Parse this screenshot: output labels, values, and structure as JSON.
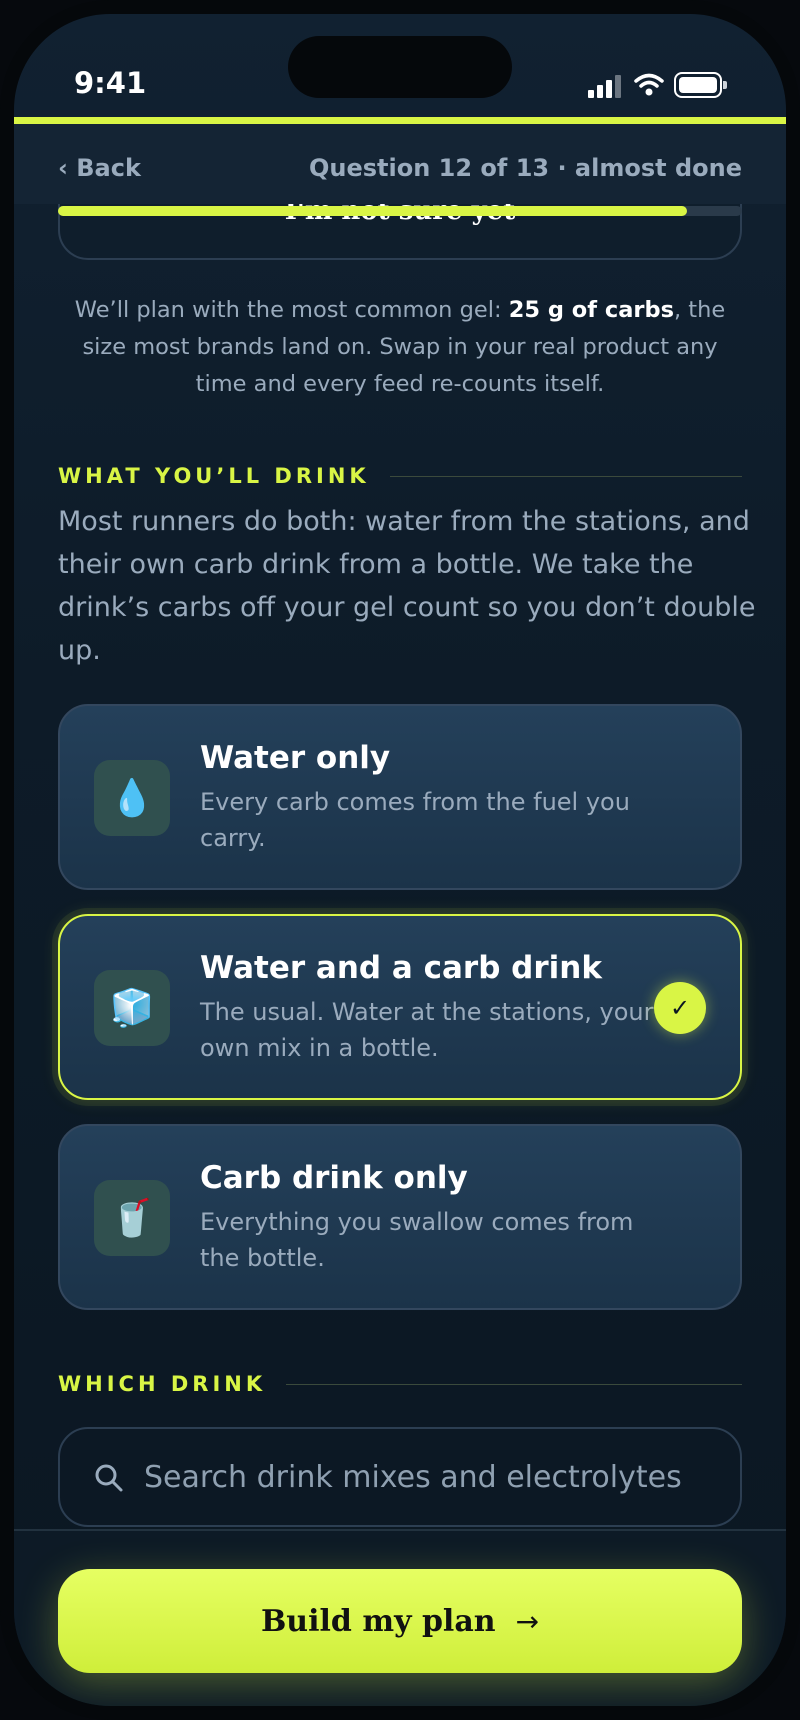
{
  "status_bar": {
    "time": "9:41"
  },
  "header": {
    "back_label": "‹ Back",
    "question_count": "Question 12 of 13 · almost done",
    "progress": 0.92
  },
  "gel": {
    "selected_option_label": "I'm not sure yet",
    "note_before": "We’ll plan with the most common gel: ",
    "note_bold": "25 g of carbs",
    "note_after": ", the size most brands land on. Swap in your real product any time and every feed re-counts itself."
  },
  "drink_section": {
    "heading": "WHAT YOU’LL DRINK",
    "intro": "Most runners do both: water from the stations, and their own carb drink from a bottle. We take the drink’s carbs off your gel count so you don’t double up.",
    "options": [
      {
        "icon": "water-drop-icon",
        "glyph": "💧",
        "title": "Water only",
        "description": "Every carb comes from the fuel you carry.",
        "selected": false
      },
      {
        "icon": "ice-cube-icon",
        "glyph": "🧊",
        "title": "Water and a carb drink",
        "description": "The usual. Water at the stations, your own mix in a bottle.",
        "selected": true,
        "check": "✓"
      },
      {
        "icon": "cup-with-straw-icon",
        "glyph": "🥤",
        "title": "Carb drink only",
        "description": "Everything you swallow comes from the bottle.",
        "selected": false
      }
    ]
  },
  "which_drink": {
    "heading": "WHICH DRINK",
    "search_placeholder": "Search drink mixes and electrolytes"
  },
  "cta": {
    "label": "Build my plan",
    "arrow": "→"
  },
  "colors": {
    "accent": "#d9f545",
    "background": "#0d1b28",
    "card": "#1f3a52",
    "muted_text": "#9aabbd"
  }
}
